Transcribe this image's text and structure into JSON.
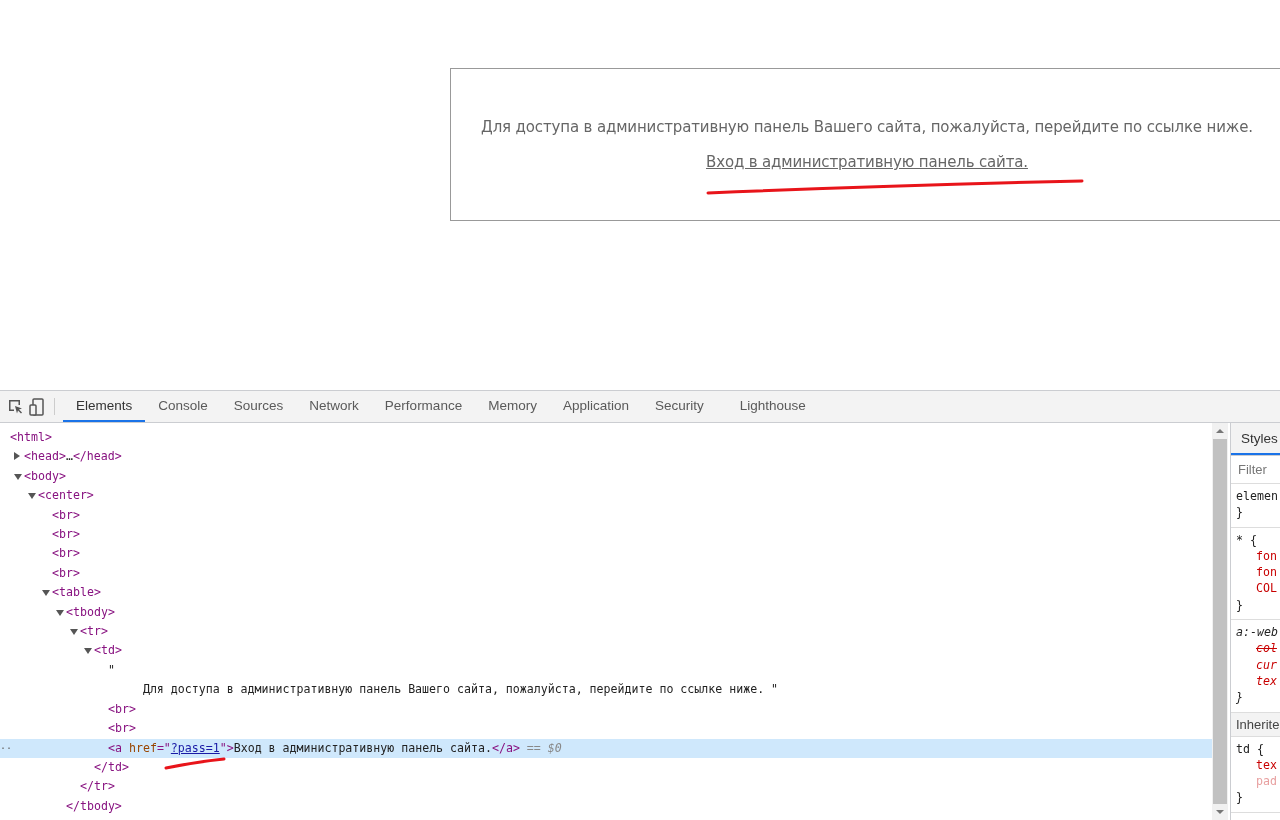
{
  "page": {
    "message": "Для доступа в административную панель Вашего сайта, пожалуйста, перейдите по ссылке ниже.",
    "link": "Вход в административную панель сайта."
  },
  "devtools": {
    "tabs": [
      {
        "label": "Elements",
        "selected": true
      },
      {
        "label": "Console",
        "selected": false
      },
      {
        "label": "Sources",
        "selected": false
      },
      {
        "label": "Network",
        "selected": false
      },
      {
        "label": "Performance",
        "selected": false
      },
      {
        "label": "Memory",
        "selected": false
      },
      {
        "label": "Application",
        "selected": false
      },
      {
        "label": "Security",
        "selected": false
      },
      {
        "label": "Lighthouse",
        "selected": false
      }
    ],
    "dom_tree": [
      {
        "selected": false,
        "markup": [
          {
            "kind": "tag",
            "text": "<html>"
          }
        ],
        "children": [
          {
            "selected": false,
            "expanded": false,
            "markup": [
              {
                "kind": "tag",
                "text": "<head>"
              },
              {
                "kind": "text",
                "text": "…"
              },
              {
                "kind": "tag",
                "text": "</head>"
              }
            ]
          },
          {
            "selected": false,
            "expanded": true,
            "markup": [
              {
                "kind": "tag",
                "text": "<body>"
              }
            ],
            "children": [
              {
                "selected": false,
                "expanded": true,
                "markup": [
                  {
                    "kind": "tag",
                    "text": "<center>"
                  }
                ],
                "children": [
                  {
                    "selected": false,
                    "markup": [
                      {
                        "kind": "tag",
                        "text": "<br>"
                      }
                    ]
                  },
                  {
                    "selected": false,
                    "markup": [
                      {
                        "kind": "tag",
                        "text": "<br>"
                      }
                    ]
                  },
                  {
                    "selected": false,
                    "markup": [
                      {
                        "kind": "tag",
                        "text": "<br>"
                      }
                    ]
                  },
                  {
                    "selected": false,
                    "markup": [
                      {
                        "kind": "tag",
                        "text": "<br>"
                      }
                    ]
                  },
                  {
                    "selected": false,
                    "expanded": true,
                    "markup": [
                      {
                        "kind": "tag",
                        "text": "<table>"
                      }
                    ],
                    "children": [
                      {
                        "selected": false,
                        "expanded": true,
                        "markup": [
                          {
                            "kind": "tag",
                            "text": "<tbody>"
                          }
                        ],
                        "closing": [
                          {
                            "kind": "tag",
                            "text": "</tbody>"
                          }
                        ],
                        "children": [
                          {
                            "selected": false,
                            "expanded": true,
                            "markup": [
                              {
                                "kind": "tag",
                                "text": "<tr>"
                              }
                            ],
                            "closing": [
                              {
                                "kind": "tag",
                                "text": "</tr>"
                              }
                            ],
                            "children": [
                              {
                                "selected": false,
                                "expanded": true,
                                "markup": [
                                  {
                                    "kind": "tag",
                                    "text": "<td>"
                                  }
                                ],
                                "closing": [
                                  {
                                    "kind": "tag",
                                    "text": "</td>"
                                  }
                                ],
                                "children": [
                                  {
                                    "selected": false,
                                    "markup": [
                                      {
                                        "kind": "text",
                                        "text": "\"\n     Для доступа в административную панель Вашего сайта, пожалуйста, перейдите по ссылке ниже. \""
                                      }
                                    ]
                                  },
                                  {
                                    "selected": false,
                                    "markup": [
                                      {
                                        "kind": "tag",
                                        "text": "<br>"
                                      }
                                    ]
                                  },
                                  {
                                    "selected": false,
                                    "markup": [
                                      {
                                        "kind": "tag",
                                        "text": "<br>"
                                      }
                                    ]
                                  },
                                  {
                                    "selected": true,
                                    "gutter": "··",
                                    "markup": [
                                      {
                                        "kind": "tag",
                                        "text": "<a"
                                      },
                                      {
                                        "kind": "attr",
                                        "text": " href"
                                      },
                                      {
                                        "kind": "tag",
                                        "text": "=\""
                                      },
                                      {
                                        "kind": "link",
                                        "text": "?pass=1"
                                      },
                                      {
                                        "kind": "tag",
                                        "text": "\">"
                                      },
                                      {
                                        "kind": "text",
                                        "text": "Вход в административную панель сайта."
                                      },
                                      {
                                        "kind": "tag",
                                        "text": "</a>"
                                      },
                                      {
                                        "kind": "dim",
                                        "text": " == $0"
                                      }
                                    ]
                                  }
                                ]
                              }
                            ]
                          }
                        ]
                      }
                    ]
                  }
                ]
              }
            ]
          }
        ]
      }
    ],
    "styles_pane": {
      "tabs": [
        {
          "label": "Styles",
          "selected": true
        }
      ],
      "filter": {
        "placeholder": "Filter"
      },
      "blocks": [
        {
          "kind": "rule",
          "user_agent": false,
          "lines": [
            {
              "kind": "selector",
              "text": "elemen"
            },
            {
              "kind": "brace",
              "text": "}"
            }
          ]
        },
        {
          "kind": "rule",
          "user_agent": false,
          "lines": [
            {
              "kind": "selector",
              "text": "* {"
            },
            {
              "kind": "prop",
              "struck": false,
              "inactive": false,
              "text": "fon"
            },
            {
              "kind": "prop",
              "struck": false,
              "inactive": false,
              "text": "fon"
            },
            {
              "kind": "prop",
              "struck": false,
              "inactive": false,
              "text": "COL"
            },
            {
              "kind": "brace",
              "text": "}"
            }
          ]
        },
        {
          "kind": "rule",
          "user_agent": true,
          "lines": [
            {
              "kind": "selector",
              "text": "a:-web"
            },
            {
              "kind": "prop",
              "struck": true,
              "inactive": false,
              "text": "col"
            },
            {
              "kind": "prop",
              "struck": false,
              "inactive": false,
              "text": "cur"
            },
            {
              "kind": "prop",
              "struck": false,
              "inactive": false,
              "text": "tex"
            },
            {
              "kind": "brace",
              "text": "}"
            }
          ]
        },
        {
          "kind": "header",
          "text": "Inherite"
        },
        {
          "kind": "rule",
          "user_agent": false,
          "lines": [
            {
              "kind": "selector",
              "text": "td {"
            },
            {
              "kind": "prop",
              "struck": false,
              "inactive": false,
              "text": "tex"
            },
            {
              "kind": "prop",
              "struck": false,
              "inactive": true,
              "text": "pad"
            },
            {
              "kind": "brace",
              "text": "}"
            }
          ]
        }
      ]
    }
  }
}
